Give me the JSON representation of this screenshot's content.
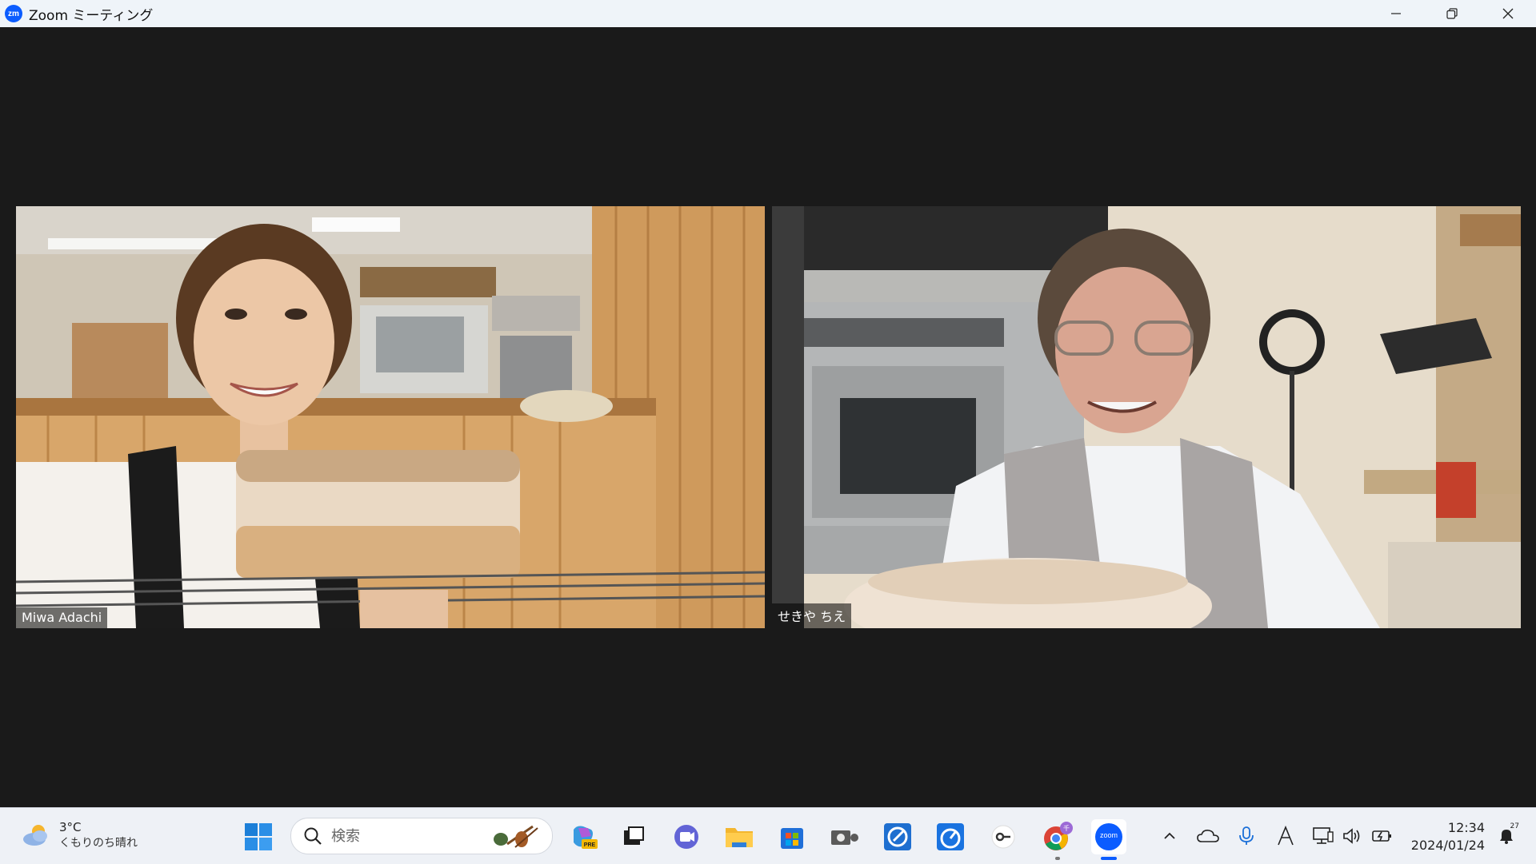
{
  "window": {
    "title": "Zoom ミーティング",
    "logo_text": "zm"
  },
  "participants": [
    {
      "name": "Miwa Adachi"
    },
    {
      "name": "せきや ちえ"
    }
  ],
  "taskbar": {
    "weather": {
      "temp": "3°C",
      "desc": "くもりのち晴れ"
    },
    "search": {
      "placeholder": "検索"
    },
    "apps": [
      "copilot-pre",
      "task-view",
      "teams-chat",
      "file-explorer",
      "microsoft-store",
      "camera",
      "app-blue-1",
      "app-blue-2",
      "app-key",
      "chrome",
      "zoom"
    ],
    "zoom_label": "zoom",
    "clock": {
      "time": "12:34",
      "date": "2024/01/24"
    },
    "notification_count": "27"
  },
  "colors": {
    "zoom_blue": "#0b5cff",
    "meeting_bg": "#1a1a1a",
    "titlebar_bg": "#eff4f9",
    "taskbar_bg": "#eef1f6"
  }
}
